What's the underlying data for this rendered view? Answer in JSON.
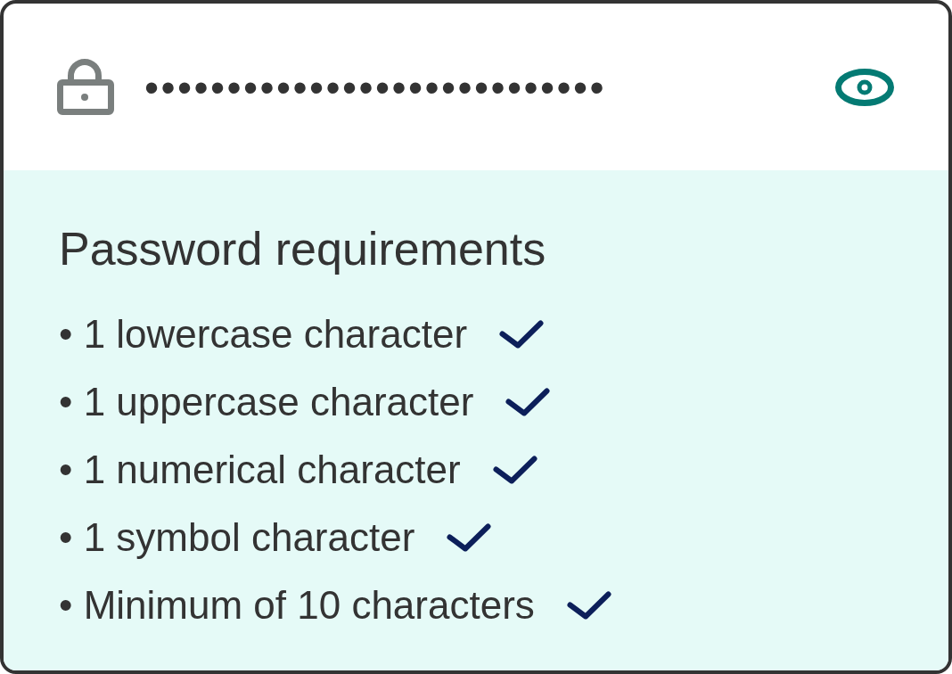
{
  "password_field": {
    "value": "••••••••••••••••••••••••••••"
  },
  "requirements": {
    "title": "Password requirements",
    "items": [
      {
        "label": "• 1 lowercase character",
        "met": true
      },
      {
        "label": "• 1 uppercase character",
        "met": true
      },
      {
        "label": "• 1 numerical character",
        "met": true
      },
      {
        "label": "• 1 symbol character",
        "met": true
      },
      {
        "label": "• Minimum of 10 characters",
        "met": true
      }
    ]
  }
}
